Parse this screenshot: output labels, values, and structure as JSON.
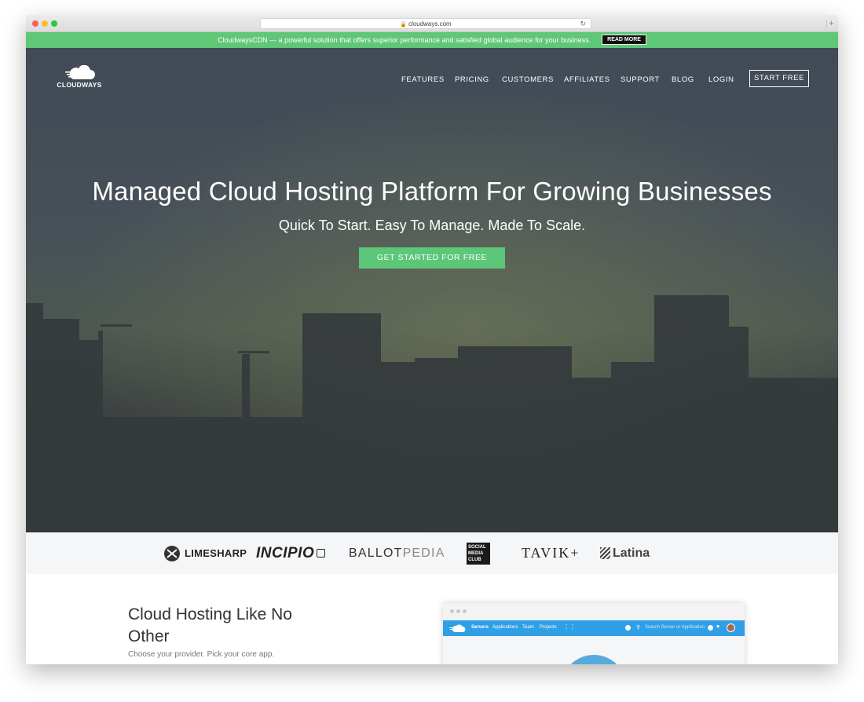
{
  "browser": {
    "url": "cloudways.com"
  },
  "promo": {
    "text": "CloudwaysCDN — a powerful solution that offers superior performance and satisfied global audience for your business.",
    "button": "READ MORE"
  },
  "header": {
    "logo_text": "CLOUDWAYS",
    "nav": [
      "FEATURES",
      "PRICING",
      "CUSTOMERS",
      "AFFILIATES",
      "SUPPORT",
      "BLOG",
      "LOGIN"
    ],
    "cta": "START FREE"
  },
  "hero": {
    "title": "Managed Cloud Hosting Platform For Growing Businesses",
    "subtitle": "Quick To Start. Easy To Manage. Made To Scale.",
    "cta": "GET STARTED FOR FREE"
  },
  "clients": {
    "limesharp": "LIMESHARP",
    "incipio": "INCIPIO",
    "ballot": "BALLOT",
    "pedia": "PEDIA",
    "smc": [
      "SOCIAL",
      "MEDIA",
      "CLUB"
    ],
    "tavik": "TAVIK+",
    "latina": "Latina"
  },
  "section": {
    "title": "Cloud Hosting Like No Other",
    "subtitle": "Choose your provider. Pick your core app."
  },
  "mockup": {
    "nav": [
      "Servers",
      "Applications",
      "Team",
      "Projects"
    ],
    "search_placeholder": "Search Server or Application"
  },
  "colors": {
    "brand_green": "#5cc679",
    "promo_green": "#60c776",
    "mock_blue": "#2f9fe6"
  }
}
